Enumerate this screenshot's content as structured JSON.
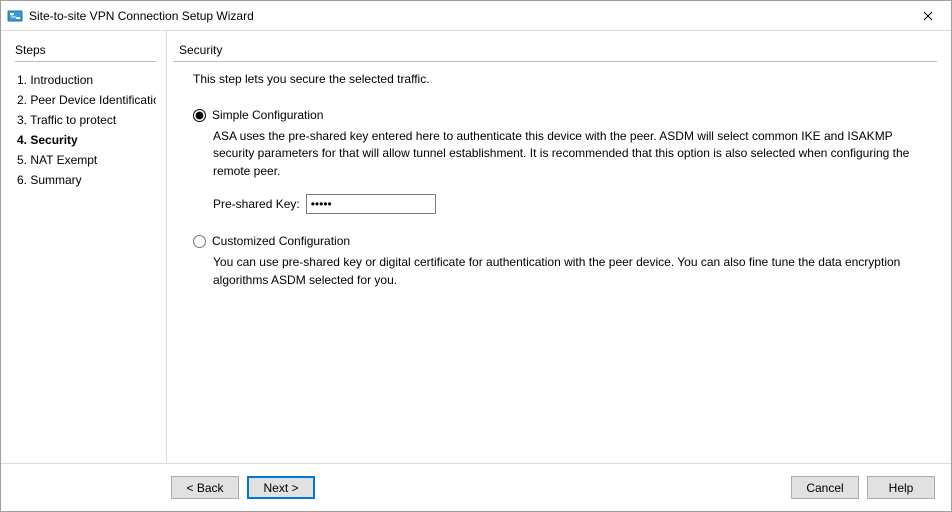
{
  "window": {
    "title": "Site-to-site VPN Connection Setup Wizard"
  },
  "steps": {
    "heading": "Steps",
    "items": [
      {
        "label": "1. Introduction"
      },
      {
        "label": "2. Peer Device Identificatio"
      },
      {
        "label": "3. Traffic to protect"
      },
      {
        "label": "4. Security",
        "active": true
      },
      {
        "label": "5. NAT Exempt"
      },
      {
        "label": "6. Summary"
      }
    ]
  },
  "content": {
    "heading": "Security",
    "intro": "This step lets you secure the selected traffic.",
    "simple": {
      "label": "Simple Configuration",
      "selected": true,
      "description": "ASA uses the pre-shared key entered here to authenticate this device with the peer. ASDM will select common IKE and ISAKMP security parameters for that will allow tunnel establishment. It is recommended that this option is also selected when configuring the remote peer.",
      "psk_label": "Pre-shared Key:",
      "psk_value": "•••••"
    },
    "custom": {
      "label": "Customized Configuration",
      "selected": false,
      "description": "You can use pre-shared key or digital certificate for authentication with the peer device. You can also fine tune the data encryption algorithms ASDM selected for you."
    }
  },
  "buttons": {
    "back": "< Back",
    "next": "Next >",
    "cancel": "Cancel",
    "help": "Help"
  }
}
